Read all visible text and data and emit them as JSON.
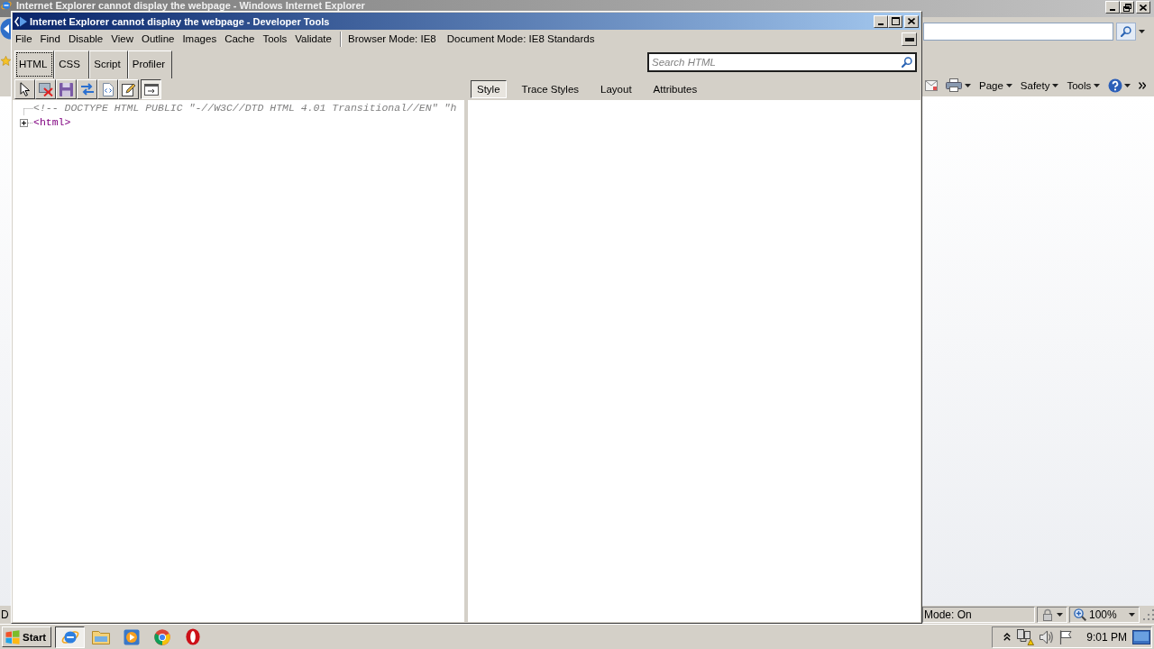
{
  "browser_window": {
    "title": "Internet Explorer cannot display the webpage - Windows Internet Explorer",
    "command_bar": [
      {
        "kind": "mail"
      },
      {
        "kind": "print"
      },
      {
        "kind": "menu",
        "label": "Page"
      },
      {
        "kind": "menu",
        "label": "Safety"
      },
      {
        "kind": "menu",
        "label": "Tools"
      },
      {
        "kind": "help"
      },
      {
        "kind": "more"
      }
    ],
    "status_bar": {
      "text": "D",
      "protected_mode": "Mode: On",
      "zoom": "100%"
    }
  },
  "devtools": {
    "title": "Internet Explorer cannot display the webpage - Developer Tools",
    "menu": [
      "File",
      "Find",
      "Disable",
      "View",
      "Outline",
      "Images",
      "Cache",
      "Tools",
      "Validate"
    ],
    "modes": [
      "Browser Mode: IE8",
      "Document Mode: IE8 Standards"
    ],
    "tabs": [
      {
        "label": "HTML",
        "selected": true
      },
      {
        "label": "CSS",
        "selected": false
      },
      {
        "label": "Script",
        "selected": false
      },
      {
        "label": "Profiler",
        "selected": false
      }
    ],
    "search": {
      "placeholder": "Search HTML"
    },
    "toolbar": [
      {
        "kind": "select",
        "pressed": false
      },
      {
        "kind": "clear",
        "pressed": false
      },
      {
        "kind": "save",
        "pressed": false
      },
      {
        "kind": "refresh",
        "pressed": false
      },
      {
        "kind": "source",
        "pressed": false
      },
      {
        "kind": "edit",
        "pressed": false
      },
      {
        "kind": "wrap",
        "pressed": true
      }
    ],
    "pane_tabs": [
      {
        "label": "Style",
        "selected": true
      },
      {
        "label": "Trace Styles",
        "selected": false
      },
      {
        "label": "Layout",
        "selected": false
      },
      {
        "label": "Attributes",
        "selected": false
      }
    ],
    "tree": [
      {
        "kind": "comment",
        "text": "<!-- DOCTYPE HTML PUBLIC \"-//W3C//DTD HTML 4.01 Transitional//EN\" \"h"
      },
      {
        "kind": "element",
        "text": "<html>",
        "expanded": false
      }
    ]
  },
  "taskbar": {
    "start": "Start",
    "apps": [
      {
        "kind": "browser",
        "selected": true
      },
      {
        "kind": "folder",
        "selected": false
      },
      {
        "kind": "player",
        "selected": false
      },
      {
        "kind": "ring",
        "selected": false
      },
      {
        "kind": "oval",
        "selected": false
      }
    ],
    "tray": [
      {
        "kind": "chevron"
      },
      {
        "kind": "network"
      },
      {
        "kind": "volume"
      },
      {
        "kind": "flag"
      }
    ],
    "clock": "9:01 PM"
  }
}
